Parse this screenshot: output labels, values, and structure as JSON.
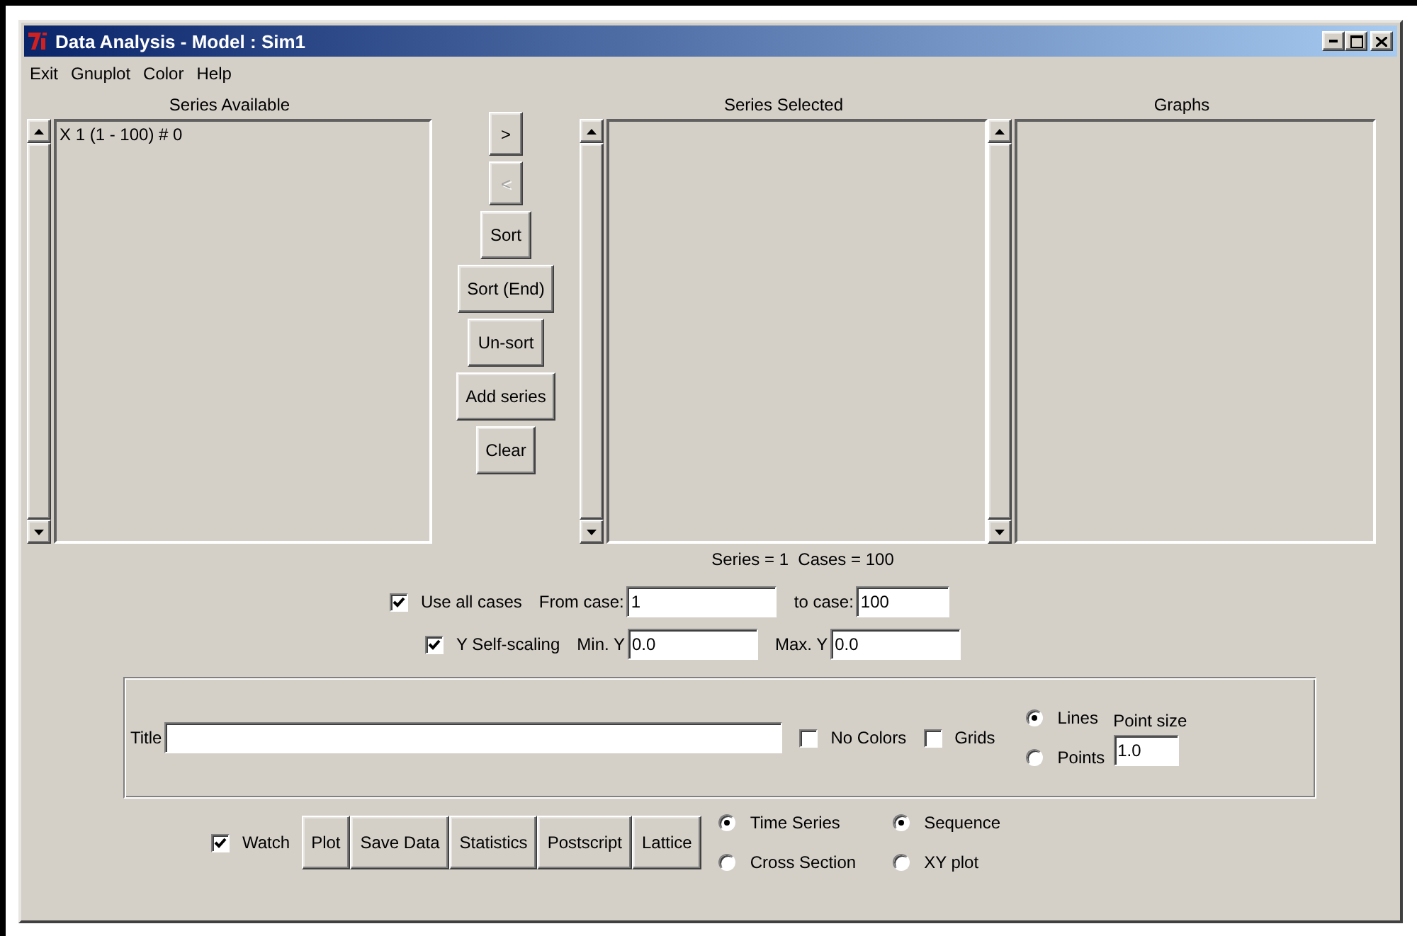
{
  "window": {
    "title": "Data Analysis - Model : Sim1"
  },
  "menu": [
    "Exit",
    "Gnuplot",
    "Color",
    "Help"
  ],
  "panels": [
    {
      "header": "Series Available",
      "items": [
        "X 1 (1 - 100) # 0"
      ]
    },
    {
      "header": "Series Selected"
    },
    {
      "header": "Graphs"
    }
  ],
  "move_buttons": [
    {
      "label": ">",
      "disabled": false
    },
    {
      "label": "<",
      "disabled": true
    },
    {
      "label": "Sort",
      "disabled": false
    },
    {
      "label": "Sort (End)",
      "disabled": false
    },
    {
      "label": "Un-sort",
      "disabled": false
    },
    {
      "label": "Add series",
      "disabled": false
    },
    {
      "label": "Clear",
      "disabled": false
    }
  ],
  "status": "Series = 1  Cases = 100",
  "case_range": {
    "use_all": {
      "label": "Use all cases",
      "checked": true
    },
    "from": {
      "label": "From case:",
      "value": "1"
    },
    "to": {
      "label": "to case:",
      "value": "100"
    }
  },
  "y_scaling": {
    "self_scaling": {
      "label": "Y Self-scaling",
      "checked": true
    },
    "min": {
      "label": "Min. Y",
      "value": "0.0"
    },
    "max": {
      "label": "Max. Y",
      "value": "0.0"
    }
  },
  "plot_options": {
    "title": {
      "label": "Title"
    },
    "checks": [
      {
        "label": "No Colors",
        "checked": false
      },
      {
        "label": "Grids",
        "checked": false
      }
    ],
    "style": [
      {
        "label": "Lines",
        "selected": true
      },
      {
        "label": "Points",
        "selected": false
      }
    ],
    "point_size": {
      "label": "Point size",
      "value": "1.0"
    }
  },
  "actions": {
    "watch": {
      "label": "Watch",
      "checked": true
    },
    "buttons": [
      "Plot",
      "Save Data",
      "Statistics",
      "Postscript",
      "Lattice"
    ],
    "data_type": [
      {
        "label": "Time Series",
        "selected": true
      },
      {
        "label": "Cross Section",
        "selected": false
      }
    ],
    "plot_type": [
      {
        "label": "Sequence",
        "selected": true
      },
      {
        "label": "XY plot",
        "selected": false
      }
    ]
  }
}
